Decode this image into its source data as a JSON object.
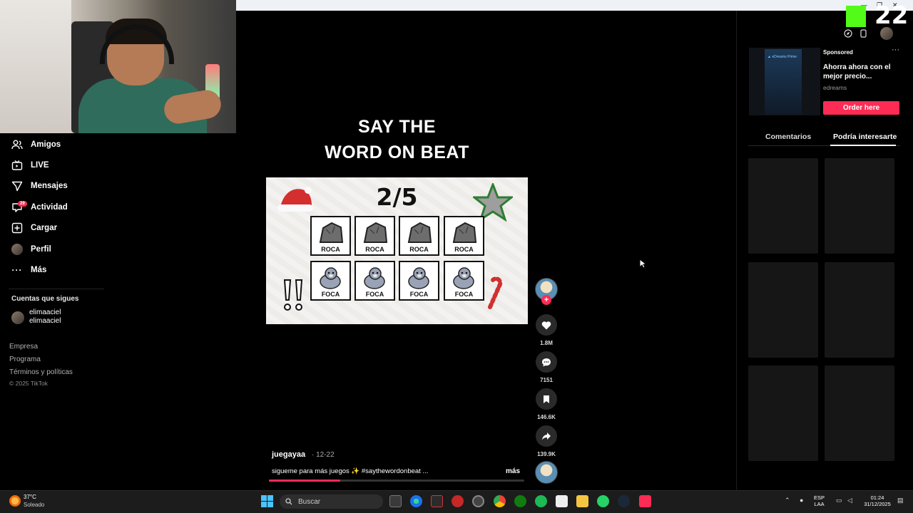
{
  "overlay": {
    "kick_number": "22"
  },
  "sidebar": {
    "items": [
      {
        "label": "Amigos",
        "icon": "friends-icon"
      },
      {
        "label": "LIVE",
        "icon": "live-icon"
      },
      {
        "label": "Mensajes",
        "icon": "messages-icon"
      },
      {
        "label": "Actividad",
        "icon": "activity-icon"
      },
      {
        "label": "Cargar",
        "icon": "upload-icon"
      },
      {
        "label": "Perfil",
        "icon": "profile-avatar"
      },
      {
        "label": "Más",
        "icon": "more-icon"
      }
    ],
    "activity_badge": "29",
    "following_title": "Cuentas que sigues",
    "following": [
      {
        "display_name": "elimaaciel",
        "username": "elimaaciel"
      }
    ],
    "footer_links": [
      "Empresa",
      "Programa",
      "Términos y políticas"
    ],
    "copyright": "© 2025 TikTok"
  },
  "video": {
    "title_line1": "SAY THE",
    "title_line2": "WORD ON BEAT",
    "counter": "2/5",
    "row1": [
      "ROCA",
      "ROCA",
      "ROCA",
      "ROCA"
    ],
    "row2": [
      "FOCA",
      "FOCA",
      "FOCA",
      "FOCA"
    ],
    "author": "juegayaa",
    "date": " · 12-22",
    "caption": "sigueme para más juegos ✨ #saythewordonbeat ...",
    "more_label": "más",
    "progress": 0.28
  },
  "actions": {
    "likes": "1.8M",
    "comments": "7151",
    "saves": "146.6K",
    "shares": "139.9K"
  },
  "ad": {
    "sponsored": "Sponsored",
    "headline": "Ahorra ahora con el mejor precio...",
    "source": "edreams",
    "cta": "Order here",
    "thumb_text": "▲ eDreams Prime"
  },
  "right_tabs": {
    "comments": "Comentarios",
    "suggested": "Podría interesarte"
  },
  "taskbar": {
    "temperature": "37°C",
    "weather": "Soleado",
    "search_placeholder": "Buscar",
    "lang_top": "ESP",
    "lang_bottom": "LAA",
    "time": "01:24",
    "date": "31/12/2025"
  },
  "colors": {
    "accent": "#fe2c55",
    "kick_green": "#53fc18",
    "background": "#000000"
  }
}
